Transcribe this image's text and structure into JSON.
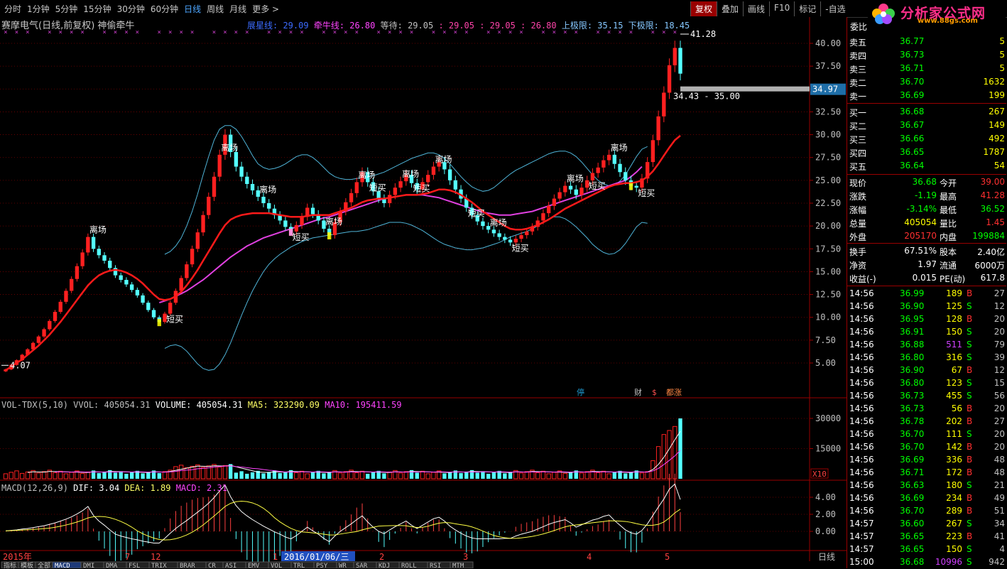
{
  "tabs": [
    "分时",
    "1分钟",
    "5分钟",
    "15分钟",
    "30分钟",
    "60分钟",
    "日线",
    "周线",
    "月线",
    "更多 >"
  ],
  "active_tab": "日线",
  "tools": [
    "复权",
    "叠加",
    "画线",
    "F10",
    "标记",
    "-自选"
  ],
  "logo": {
    "title": "分析家公式网",
    "url": "www.88gs.com"
  },
  "chart_title": "赛摩电气(日线,前复权) 神偷牵牛",
  "indicators": {
    "line1_label": "展星线: 29.09",
    "line2_label": "牵牛线: 26.80",
    "wait_label": "等待: 29.05",
    "wait_vals": ": 29.05 : 29.05 : 26.80",
    "upper_label": "上极限: 35.15",
    "lower_label": "下极限: 18.45"
  },
  "price_axis": [
    "40.00",
    "37.50",
    "35.00",
    "32.50",
    "30.00",
    "27.50",
    "25.00",
    "22.50",
    "20.00",
    "17.50",
    "15.00",
    "12.50",
    "10.00",
    "7.50",
    "5.00"
  ],
  "price_marker": "34.97",
  "range_text": "34.43 - 35.00",
  "high_label": "41.28",
  "low_label": "4.07",
  "annotations": [
    "离场",
    "短买",
    "离场",
    "离场",
    "短买",
    "离场",
    "离场",
    "短买",
    "离场",
    "短买",
    "离场",
    "短买",
    "离场",
    "短买",
    "离场",
    "短买",
    "离场",
    "短买"
  ],
  "event_tags": [
    "停",
    "财",
    "$",
    "都涨"
  ],
  "volume_header": {
    "name": "VOL-TDX(5,10)",
    "vvol": "VVOL: 405054.31",
    "volume": "VOLUME: 405054.31",
    "ma5": "MA5: 323290.09",
    "ma10": "MA10: 195411.59"
  },
  "volume_axis": [
    "30000",
    "15000"
  ],
  "volume_unit": "X10",
  "macd_header": {
    "name": "MACD(12,26,9)",
    "dif": "DIF: 3.04",
    "dea": "DEA: 1.89",
    "macd": "MACD: 2.31"
  },
  "macd_axis": [
    "4.00",
    "2.00",
    "0.00"
  ],
  "date_labels": [
    "2015年",
    "7",
    "12",
    "1",
    "2016/01/06/三",
    "2",
    "3",
    "4",
    "5"
  ],
  "period_label": "日线",
  "bottom_tabs": [
    "指标",
    "模板",
    "全部",
    "MACD",
    "DMI",
    "DMA",
    "FSL",
    "TRIX",
    "BRAR",
    "CR",
    "ASI",
    "EMV",
    "VOL",
    "TRL",
    "PSY",
    "WR",
    "SAR",
    "KDJ",
    "ROLL",
    "RSI",
    "MTM"
  ],
  "quote": {
    "header": "委比",
    "asks": [
      {
        "label": "卖五",
        "price": "36.77",
        "vol": "5"
      },
      {
        "label": "卖四",
        "price": "36.73",
        "vol": "5"
      },
      {
        "label": "卖三",
        "price": "36.71",
        "vol": "5"
      },
      {
        "label": "卖二",
        "price": "36.70",
        "vol": "1632"
      },
      {
        "label": "卖一",
        "price": "36.69",
        "vol": "199"
      }
    ],
    "bids": [
      {
        "label": "买一",
        "price": "36.68",
        "vol": "267"
      },
      {
        "label": "买二",
        "price": "36.67",
        "vol": "149"
      },
      {
        "label": "买三",
        "price": "36.66",
        "vol": "492"
      },
      {
        "label": "买四",
        "price": "36.65",
        "vol": "1787"
      },
      {
        "label": "买五",
        "price": "36.64",
        "vol": "54"
      }
    ],
    "stats": [
      {
        "l1": "现价",
        "v1": "36.68",
        "c1": "#00ff00",
        "l2": "今开",
        "v2": "39.00",
        "c2": "#ff3030"
      },
      {
        "l1": "涨跌",
        "v1": "-1.19",
        "c1": "#00ff00",
        "l2": "最高",
        "v2": "41.28",
        "c2": "#ff3030"
      },
      {
        "l1": "涨幅",
        "v1": "-3.14%",
        "c1": "#00ff00",
        "l2": "最低",
        "v2": "36.52",
        "c2": "#00ff00"
      },
      {
        "l1": "总量",
        "v1": "405054",
        "c1": "#ffff00",
        "l2": "量比",
        "v2": "1.45",
        "c2": "#ff3030"
      },
      {
        "l1": "外盘",
        "v1": "205170",
        "c1": "#ff3030",
        "l2": "内盘",
        "v2": "199884",
        "c2": "#00ff00"
      }
    ],
    "stats2": [
      {
        "l1": "换手",
        "v1": "67.51%",
        "l2": "股本",
        "v2": "2.40亿"
      },
      {
        "l1": "净资",
        "v1": "1.97",
        "l2": "流通",
        "v2": "6000万"
      },
      {
        "l1": "收益(-)",
        "v1": "0.015",
        "l2": "PE(动)",
        "v2": "617.8"
      }
    ],
    "ticks": [
      {
        "t": "14:56",
        "p": "36.99",
        "v": "189",
        "d": "B",
        "n": "27"
      },
      {
        "t": "14:56",
        "p": "36.90",
        "v": "125",
        "d": "S",
        "n": "12"
      },
      {
        "t": "14:56",
        "p": "36.95",
        "v": "128",
        "d": "B",
        "n": "20"
      },
      {
        "t": "14:56",
        "p": "36.91",
        "v": "150",
        "d": "S",
        "n": "20"
      },
      {
        "t": "14:56",
        "p": "36.88",
        "v": "511",
        "d": "S",
        "n": "79"
      },
      {
        "t": "14:56",
        "p": "36.80",
        "v": "316",
        "d": "S",
        "n": "39"
      },
      {
        "t": "14:56",
        "p": "36.90",
        "v": "67",
        "d": "B",
        "n": "12"
      },
      {
        "t": "14:56",
        "p": "36.80",
        "v": "123",
        "d": "S",
        "n": "15"
      },
      {
        "t": "14:56",
        "p": "36.73",
        "v": "455",
        "d": "S",
        "n": "56"
      },
      {
        "t": "14:56",
        "p": "36.73",
        "v": "56",
        "d": "B",
        "n": "20"
      },
      {
        "t": "14:56",
        "p": "36.78",
        "v": "202",
        "d": "B",
        "n": "27"
      },
      {
        "t": "14:56",
        "p": "36.70",
        "v": "111",
        "d": "S",
        "n": "20"
      },
      {
        "t": "14:56",
        "p": "36.70",
        "v": "142",
        "d": "B",
        "n": "20"
      },
      {
        "t": "14:56",
        "p": "36.69",
        "v": "336",
        "d": "B",
        "n": "48"
      },
      {
        "t": "14:56",
        "p": "36.71",
        "v": "172",
        "d": "B",
        "n": "48"
      },
      {
        "t": "14:56",
        "p": "36.63",
        "v": "180",
        "d": "S",
        "n": "21"
      },
      {
        "t": "14:56",
        "p": "36.69",
        "v": "234",
        "d": "B",
        "n": "49"
      },
      {
        "t": "14:56",
        "p": "36.70",
        "v": "289",
        "d": "B",
        "n": "51"
      },
      {
        "t": "14:57",
        "p": "36.60",
        "v": "267",
        "d": "S",
        "n": "34"
      },
      {
        "t": "14:57",
        "p": "36.65",
        "v": "223",
        "d": "B",
        "n": "41"
      },
      {
        "t": "14:57",
        "p": "36.65",
        "v": "150",
        "d": "S",
        "n": "4"
      },
      {
        "t": "15:00",
        "p": "36.68",
        "v": "10996",
        "d": "S",
        "n": "942"
      }
    ]
  },
  "chart_data": {
    "type": "candlestick",
    "ylim": [
      4.07,
      41.28
    ],
    "closes": [
      4.3,
      4.8,
      5.3,
      5.9,
      6.5,
      7.2,
      7.9,
      8.7,
      9.6,
      10.6,
      11.7,
      12.9,
      14.2,
      15.6,
      17.1,
      18.8,
      17.5,
      16.8,
      16.2,
      15.4,
      14.6,
      14.1,
      13.6,
      13.0,
      12.4,
      11.6,
      10.8,
      10.0,
      9.5,
      10.4,
      11.6,
      12.9,
      14.3,
      15.8,
      17.5,
      19.3,
      21.2,
      23.2,
      25.4,
      27.8,
      30.0,
      28.1,
      26.5,
      25.4,
      24.6,
      23.9,
      23.2,
      22.5,
      21.9,
      21.2,
      20.6,
      19.9,
      19.4,
      20.1,
      21.0,
      22.0,
      21.3,
      20.6,
      19.7,
      19.0,
      20.4,
      21.6,
      22.6,
      23.6,
      24.8,
      25.9,
      24.8,
      23.8,
      23.0,
      22.5,
      23.4,
      24.2,
      24.9,
      25.6,
      24.7,
      24.0,
      24.8,
      25.6,
      26.5,
      27.0,
      26.2,
      25.0,
      24.0,
      23.0,
      22.0,
      21.2,
      20.5,
      20.0,
      19.6,
      19.2,
      18.8,
      18.5,
      18.2,
      18.6,
      19.0,
      19.4,
      19.9,
      20.6,
      21.4,
      22.2,
      23.0,
      23.7,
      24.4,
      24.0,
      23.4,
      24.2,
      25.0,
      25.8,
      26.4,
      27.2,
      27.8,
      26.8,
      25.9,
      25.0,
      24.4,
      24.2,
      25.2,
      27.0,
      29.4,
      32.0,
      34.6,
      37.6,
      39.5,
      36.68
    ],
    "ma_red": [
      4.2,
      4.6,
      5.0,
      5.4,
      5.9,
      6.4,
      6.9,
      7.5,
      8.1,
      8.8,
      9.5,
      10.3,
      11.1,
      11.9,
      12.7,
      13.5,
      14.1,
      14.6,
      14.9,
      15.1,
      15.2,
      15.1,
      14.9,
      14.6,
      14.2,
      13.7,
      13.1,
      12.5,
      12.0,
      11.9,
      12.0,
      12.3,
      12.8,
      13.5,
      14.3,
      15.2,
      16.2,
      17.2,
      18.2,
      19.2,
      20.1,
      20.7,
      21.0,
      21.2,
      21.3,
      21.4,
      21.4,
      21.4,
      21.4,
      21.3,
      21.2,
      21.1,
      21.0,
      21.0,
      21.0,
      21.1,
      21.2,
      21.2,
      21.2,
      21.2,
      21.4,
      21.6,
      21.8,
      22.0,
      22.3,
      22.6,
      22.8,
      22.9,
      23.0,
      23.0,
      23.1,
      23.2,
      23.3,
      23.4,
      23.4,
      23.4,
      23.5,
      23.6,
      23.8,
      24.0,
      24.0,
      23.9,
      23.7,
      23.4,
      23.0,
      22.6,
      22.1,
      21.6,
      21.2,
      20.8,
      20.4,
      20.0,
      19.7,
      19.6,
      19.6,
      19.7,
      19.9,
      20.1,
      20.4,
      20.7,
      21.1,
      21.5,
      21.9,
      22.2,
      22.5,
      22.8,
      23.1,
      23.4,
      23.7,
      24.0,
      24.3,
      24.5,
      24.6,
      24.7,
      24.7,
      24.8,
      25.0,
      25.4,
      26.0,
      26.8,
      27.7,
      28.6,
      29.4,
      29.9
    ],
    "ma_magenta": [
      null,
      null,
      null,
      null,
      null,
      null,
      null,
      null,
      null,
      null,
      null,
      null,
      null,
      null,
      null,
      null,
      null,
      null,
      null,
      null,
      null,
      null,
      null,
      null,
      null,
      null,
      null,
      null,
      11.6,
      11.8,
      12.0,
      12.3,
      12.6,
      12.9,
      13.3,
      13.7,
      14.1,
      14.6,
      15.1,
      15.6,
      16.1,
      16.6,
      17.0,
      17.4,
      17.8,
      18.1,
      18.4,
      18.7,
      18.9,
      19.1,
      19.3,
      19.5,
      19.7,
      19.9,
      20.1,
      20.3,
      20.5,
      20.7,
      20.9,
      21.0,
      21.2,
      21.4,
      21.6,
      21.8,
      22.0,
      22.2,
      22.4,
      22.6,
      22.8,
      23.0,
      23.1,
      23.2,
      23.3,
      23.4,
      23.4,
      23.4,
      23.4,
      23.3,
      23.2,
      23.1,
      22.9,
      22.7,
      22.5,
      22.3,
      22.1,
      21.9,
      21.7,
      21.5,
      21.4,
      21.3,
      21.2,
      21.2,
      21.2,
      21.3,
      21.4,
      21.5,
      21.6,
      21.8,
      22.0,
      22.2,
      22.4,
      22.6,
      22.8,
      23.0,
      23.2,
      23.4,
      23.6,
      23.8,
      24.0,
      24.2,
      24.4,
      24.6,
      24.8,
      25.0,
      25.4,
      25.9,
      26.5
    ],
    "bb_upper": [
      null,
      null,
      null,
      null,
      null,
      null,
      null,
      null,
      null,
      null,
      null,
      null,
      null,
      null,
      null,
      null,
      null,
      null,
      null,
      null,
      null,
      null,
      null,
      null,
      null,
      null,
      null,
      null,
      null,
      16.9,
      17.2,
      17.8,
      18.7,
      20.0,
      21.6,
      23.5,
      25.6,
      27.6,
      29.4,
      30.6,
      31.0,
      31.0,
      30.6,
      29.8,
      28.8,
      27.7,
      26.8,
      26.4,
      26.2,
      26.3,
      26.5,
      26.8,
      27.2,
      27.6,
      27.8,
      27.8,
      27.5,
      27.0,
      26.4,
      25.8,
      25.4,
      25.2,
      25.1,
      25.1,
      25.2,
      25.3,
      25.4,
      25.5,
      25.7,
      25.9,
      26.2,
      26.5,
      26.8,
      27.1,
      27.4,
      27.6,
      27.8,
      28.0,
      28.0,
      27.8,
      27.4,
      26.8,
      26.1,
      25.4,
      24.8,
      24.3,
      24.0,
      23.8,
      23.9,
      24.2,
      24.7,
      25.2,
      25.7,
      26.1,
      26.4,
      26.7,
      27.0,
      27.3,
      27.6,
      27.9,
      28.1,
      28.2,
      28.2,
      28.0,
      27.6,
      27.0,
      26.3,
      25.6,
      25.0,
      24.6,
      24.4,
      24.5,
      24.9,
      25.6,
      26.6,
      27.6,
      28.4,
      28.7,
      null,
      null,
      null
    ],
    "bb_lower": [
      null,
      null,
      null,
      null,
      null,
      null,
      null,
      null,
      null,
      null,
      null,
      null,
      null,
      null,
      null,
      null,
      null,
      null,
      null,
      null,
      null,
      null,
      null,
      null,
      null,
      null,
      null,
      null,
      null,
      6.6,
      6.9,
      7.0,
      6.8,
      6.3,
      5.6,
      4.9,
      4.4,
      4.2,
      4.3,
      4.9,
      5.9,
      7.2,
      8.7,
      10.2,
      11.6,
      12.9,
      14.0,
      15.0,
      15.8,
      16.4,
      16.9,
      17.3,
      17.7,
      18.0,
      18.3,
      18.5,
      18.7,
      18.8,
      18.9,
      19.0,
      19.1,
      19.2,
      19.3,
      19.4,
      19.4,
      19.5,
      19.6,
      19.8,
      20.0,
      20.2,
      20.4,
      20.4,
      20.4,
      20.3,
      20.1,
      19.8,
      19.5,
      19.1,
      18.7,
      18.3,
      18.0,
      17.8,
      17.6,
      17.5,
      17.4,
      17.4,
      17.5,
      17.6,
      17.8,
      18.0,
      18.2,
      18.5,
      18.8,
      19.0,
      19.2,
      19.4,
      19.7,
      20.0,
      20.4,
      20.8,
      21.0,
      21.0,
      20.8,
      20.4,
      19.9,
      19.3,
      18.7,
      18.0,
      17.5,
      17.1,
      16.9,
      17.0,
      17.4,
      18.1,
      19.0,
      19.9,
      20.4,
      20.3,
      null,
      null,
      null
    ],
    "volume_ma5_label": "MA5",
    "volume_ma10_label": "MA10"
  }
}
